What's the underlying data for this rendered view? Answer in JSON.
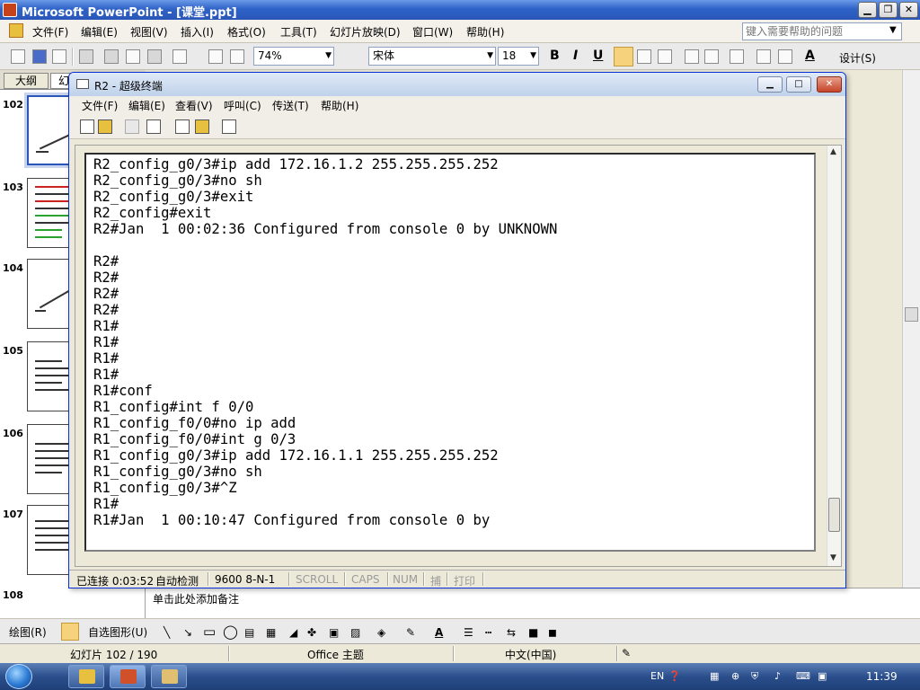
{
  "powerpoint": {
    "title": "Microsoft PowerPoint - [课堂.ppt]",
    "caption_buttons": {
      "minimize": "▁",
      "restore": "❐",
      "close": "✕"
    },
    "menu": [
      "文件(F)",
      "编辑(E)",
      "视图(V)",
      "插入(I)",
      "格式(O)",
      "工具(T)",
      "幻灯片放映(D)",
      "窗口(W)",
      "帮助(H)"
    ],
    "help_placeholder": "键入需要帮助的问题",
    "zoom": "74%",
    "font_name": "宋体",
    "font_size": "18",
    "format": {
      "bold": "B",
      "italic": "I",
      "underline": "U",
      "font_color": "A",
      "design": "设计(S)"
    },
    "panel_tabs": {
      "outline": "大纲",
      "slides": "幻"
    },
    "slide_numbers": [
      "102",
      "103",
      "104",
      "105",
      "106",
      "107",
      "108"
    ],
    "notes_placeholder": "单击此处添加备注",
    "drawing": {
      "draw_label": "绘图(R)",
      "autoshapes_label": "自选图形(U)"
    },
    "status": {
      "slide": "幻灯片 102 / 190",
      "theme": "Office 主题",
      "language": "中文(中国)"
    }
  },
  "hyperterminal": {
    "title": "R2 - 超级终端",
    "menu": [
      "文件(F)",
      "编辑(E)",
      "查看(V)",
      "呼叫(C)",
      "传送(T)",
      "帮助(H)"
    ],
    "terminal_lines": [
      "R2_config_g0/3#ip add 172.16.1.2 255.255.255.252",
      "R2_config_g0/3#no sh",
      "R2_config_g0/3#exit",
      "R2_config#exit",
      "R2#Jan  1 00:02:36 Configured from console 0 by UNKNOWN",
      "",
      "R2#",
      "R2#",
      "R2#",
      "R2#",
      "R1#",
      "R1#",
      "R1#",
      "R1#",
      "R1#conf",
      "R1_config#int f 0/0",
      "R1_config_f0/0#no ip add",
      "R1_config_f0/0#int g 0/3",
      "R1_config_g0/3#ip add 172.16.1.1 255.255.255.252",
      "R1_config_g0/3#no sh",
      "R1_config_g0/3#^Z",
      "R1#",
      "R1#Jan  1 00:10:47 Configured from console 0 by",
      "",
      "_"
    ],
    "status": {
      "connected": "已连接 0:03:52",
      "detect": "自动检测",
      "baud": "9600 8-N-1",
      "scroll": "SCROLL",
      "caps": "CAPS",
      "num": "NUM",
      "capture": "捕",
      "print": "打印"
    }
  },
  "taskbar": {
    "lang": "EN",
    "clock": "11:39"
  },
  "colors": {
    "xp_blue": "#2a56b8",
    "highlight": "#f6d27c"
  }
}
